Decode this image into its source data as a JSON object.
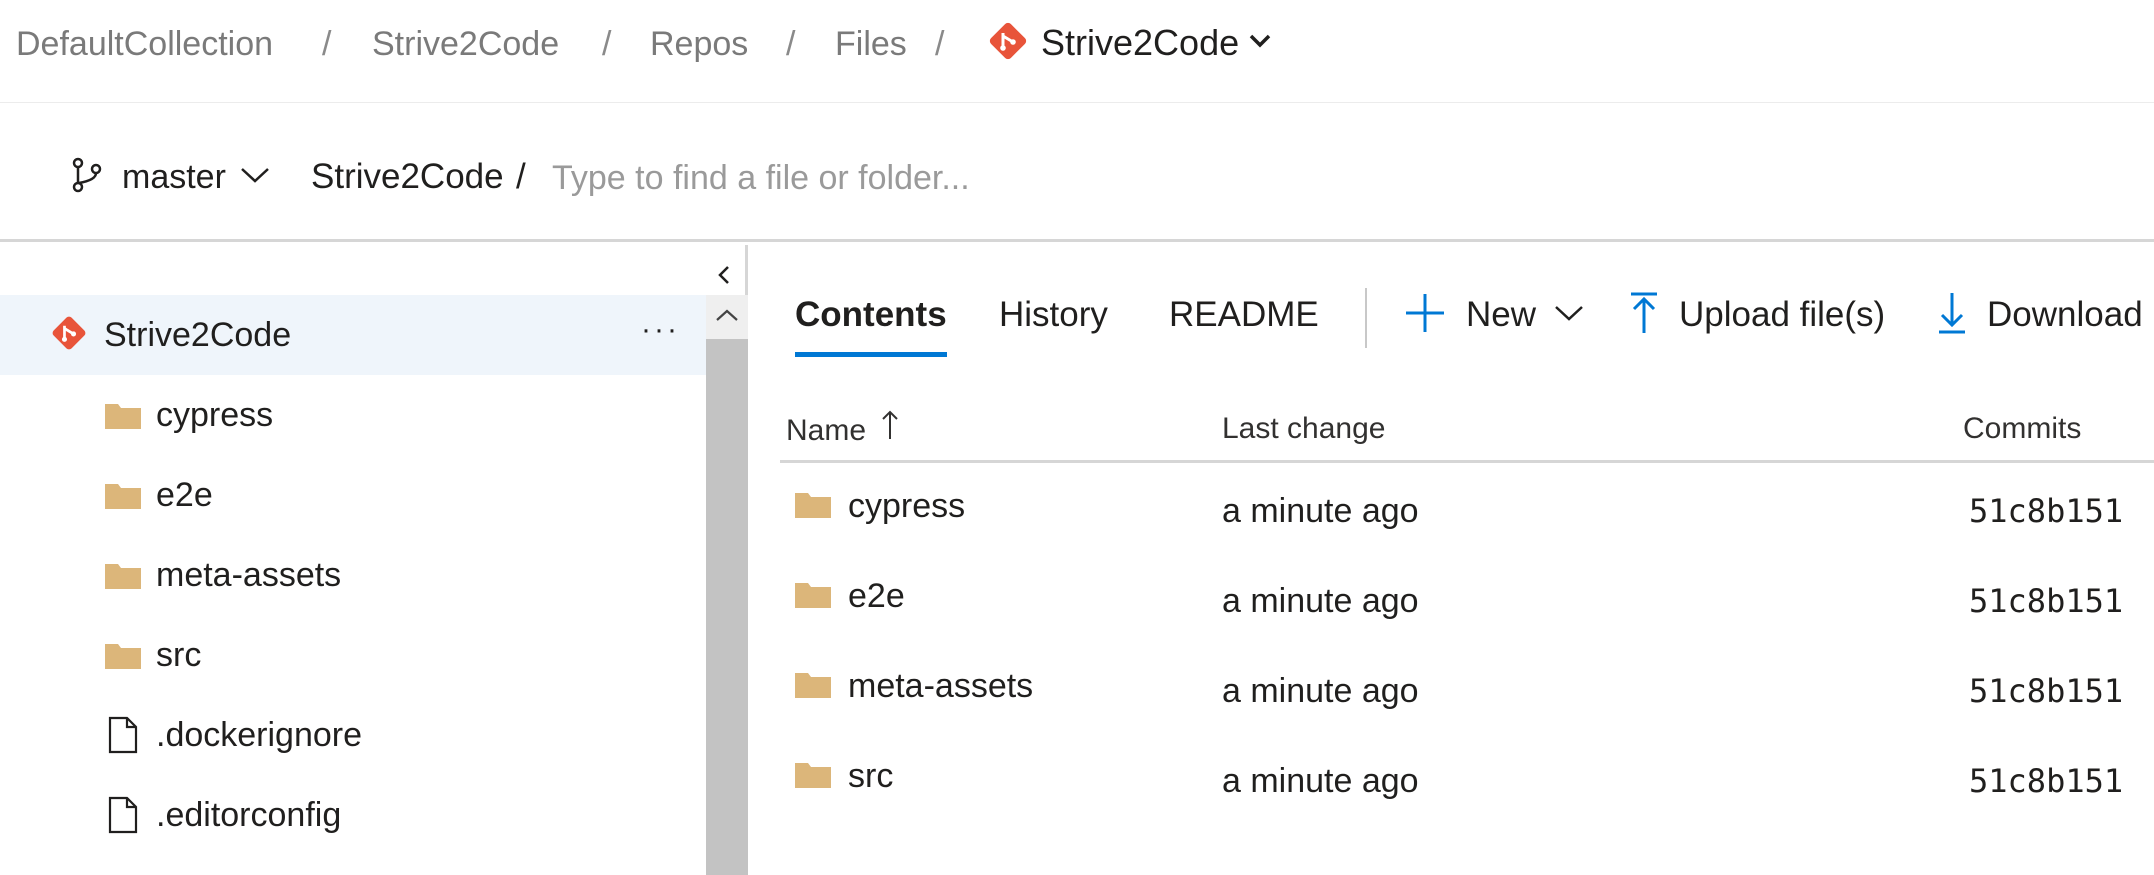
{
  "breadcrumb": {
    "items": [
      "DefaultCollection",
      "Strive2Code",
      "Repos",
      "Files"
    ],
    "separator": "/",
    "current_repo": "Strive2Code"
  },
  "pathbar": {
    "branch": "master",
    "root": "Strive2Code",
    "separator": "/",
    "placeholder": "Type to find a file or folder..."
  },
  "tree": {
    "root": {
      "label": "Strive2Code",
      "more": "···"
    },
    "items": [
      {
        "label": "cypress",
        "icon": "folder-icon"
      },
      {
        "label": "e2e",
        "icon": "folder-icon"
      },
      {
        "label": "meta-assets",
        "icon": "folder-icon"
      },
      {
        "label": "src",
        "icon": "folder-icon"
      },
      {
        "label": ".dockerignore",
        "icon": "file-icon"
      },
      {
        "label": ".editorconfig",
        "icon": "file-icon"
      }
    ]
  },
  "tabs": [
    {
      "label": "Contents",
      "active": true
    },
    {
      "label": "History",
      "active": false
    },
    {
      "label": "README",
      "active": false
    }
  ],
  "commands": {
    "new": "New",
    "upload": "Upload file(s)",
    "download": "Download"
  },
  "table": {
    "columns": {
      "name": "Name",
      "last_change": "Last change",
      "commits": "Commits"
    },
    "rows": [
      {
        "name": "cypress",
        "last_change": "a minute ago",
        "commit": "51c8b151"
      },
      {
        "name": "e2e",
        "last_change": "a minute ago",
        "commit": "51c8b151"
      },
      {
        "name": "meta-assets",
        "last_change": "a minute ago",
        "commit": "51c8b151"
      },
      {
        "name": "src",
        "last_change": "a minute ago",
        "commit": "51c8b151"
      }
    ]
  },
  "colors": {
    "accent": "#0078d4",
    "git_brand": "#e8543a",
    "folder": "#dcb67a",
    "selected_bg": "#eff5fb"
  }
}
